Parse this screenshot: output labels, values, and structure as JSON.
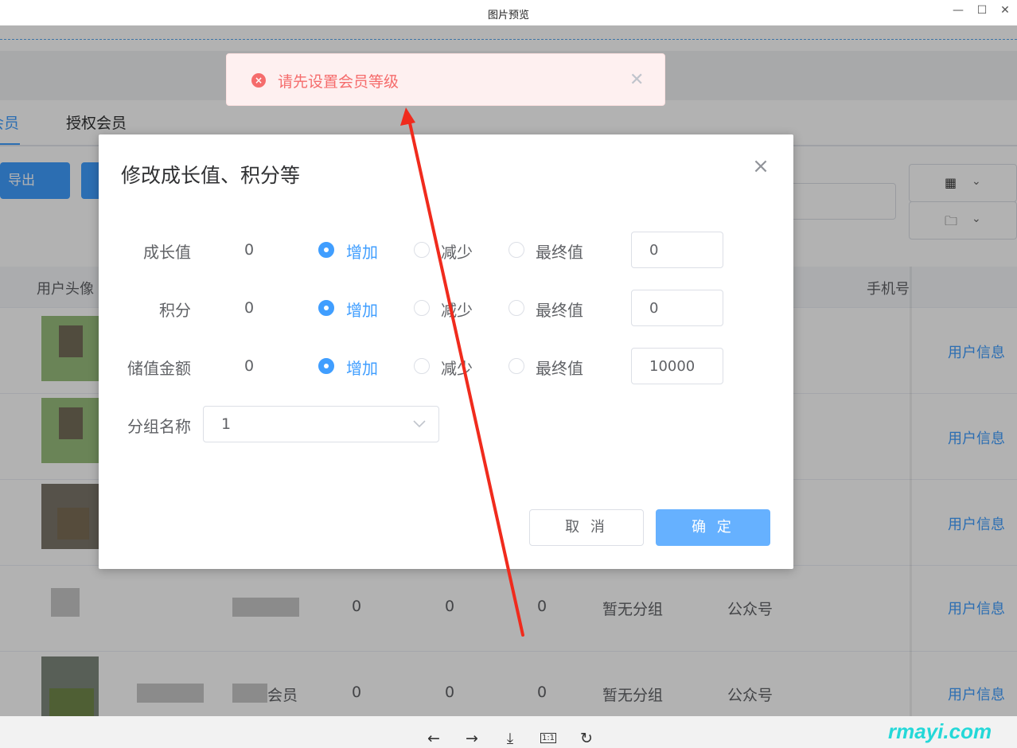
{
  "window": {
    "title": "图片预览",
    "minimize": "—",
    "maximize": "☐",
    "close": "✕"
  },
  "page": {
    "tabs": [
      {
        "label": "会员"
      },
      {
        "label": "授权会员"
      }
    ],
    "export_button": "导出",
    "table": {
      "headers": {
        "avatar": "用户头像",
        "phone": "手机号"
      },
      "rows": [
        {
          "c1": "",
          "c2": "",
          "c3": "",
          "group": "",
          "source": "",
          "action": "用户信息"
        },
        {
          "c1": "",
          "c2": "",
          "c3": "",
          "group": "",
          "source": "",
          "action": "用户信息"
        },
        {
          "c1": "",
          "c2": "",
          "c3": "",
          "group": "",
          "source": "",
          "action": "用户信息"
        },
        {
          "member": "",
          "c1": "0",
          "c2": "0",
          "c3": "0",
          "group": "暂无分组",
          "source": "公众号",
          "action": "用户信息"
        },
        {
          "member": "会员",
          "c1": "0",
          "c2": "0",
          "c3": "0",
          "group": "暂无分组",
          "source": "公众号",
          "action": "用户信息"
        }
      ]
    }
  },
  "dialog": {
    "title": "修改成长值、积分等",
    "fields": [
      {
        "label": "成长值",
        "current": "0",
        "options": [
          "增加",
          "减少",
          "最终值"
        ],
        "selected": "增加",
        "value": "0"
      },
      {
        "label": "积分",
        "current": "0",
        "options": [
          "增加",
          "减少",
          "最终值"
        ],
        "selected": "增加",
        "value": "0"
      },
      {
        "label": "储值金额",
        "current": "0",
        "options": [
          "增加",
          "减少",
          "最终值"
        ],
        "selected": "增加",
        "value": "10000"
      }
    ],
    "group": {
      "label": "分组名称",
      "value": "1"
    },
    "cancel_label": "取 消",
    "confirm_label": "确 定"
  },
  "message": {
    "type": "error",
    "text": "请先设置会员等级"
  },
  "viewer_toolbar": {
    "items": [
      "prev-icon",
      "next-icon",
      "download-icon",
      "actual-size-icon",
      "rotate-icon"
    ],
    "actual_size_label": "1:1"
  },
  "watermark": "rmayi.com",
  "colors": {
    "primary": "#409eff",
    "error": "#f56c6c",
    "annotation_arrow": "#f02b1d"
  }
}
